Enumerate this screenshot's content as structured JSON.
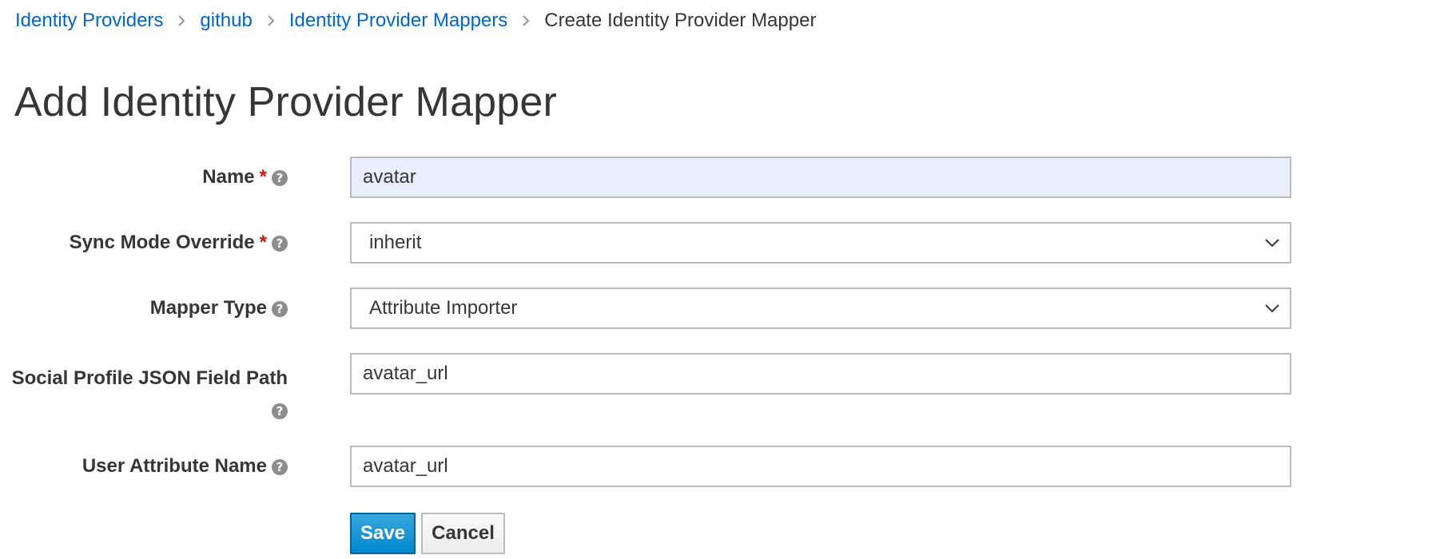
{
  "breadcrumb": {
    "items": [
      {
        "label": "Identity Providers",
        "link": true
      },
      {
        "label": "github",
        "link": true
      },
      {
        "label": "Identity Provider Mappers",
        "link": true
      },
      {
        "label": "Create Identity Provider Mapper",
        "link": false
      }
    ]
  },
  "page": {
    "title": "Add Identity Provider Mapper"
  },
  "form": {
    "name": {
      "label": "Name",
      "required_mark": "*",
      "value": "avatar"
    },
    "sync_mode": {
      "label": "Sync Mode Override",
      "required_mark": "*",
      "selected": "inherit"
    },
    "mapper_type": {
      "label": "Mapper Type",
      "selected": "Attribute Importer"
    },
    "json_field_path": {
      "label": "Social Profile JSON Field Path",
      "value": "avatar_url"
    },
    "user_attribute": {
      "label": "User Attribute Name",
      "value": "avatar_url"
    },
    "help_glyph": "?"
  },
  "actions": {
    "save_label": "Save",
    "cancel_label": "Cancel"
  },
  "colors": {
    "link": "#0066cc",
    "required": "#c9190b",
    "primary_button": "#0088ce",
    "autofill_background": "#e8eefb"
  }
}
